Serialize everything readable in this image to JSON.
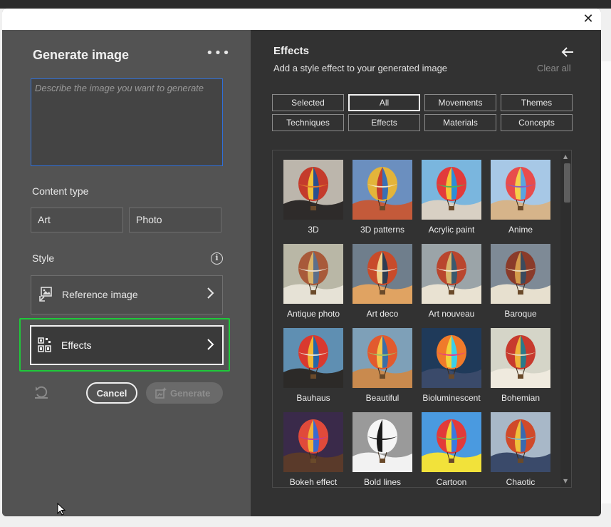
{
  "dialog": {
    "close_icon": "close-icon"
  },
  "left_panel": {
    "title": "Generate image",
    "more_label": "•••",
    "prompt": {
      "placeholder": "Describe the image you want to generate",
      "value": ""
    },
    "content_type": {
      "label": "Content type",
      "options": [
        "Art",
        "Photo"
      ]
    },
    "style": {
      "label": "Style",
      "info_glyph": "i",
      "reference_image_label": "Reference image",
      "effects_label": "Effects"
    },
    "actions": {
      "cancel": "Cancel",
      "generate": "Generate"
    }
  },
  "right_panel": {
    "title": "Effects",
    "subtitle": "Add a style effect to your generated image",
    "clear_all": "Clear all",
    "filters": [
      "Selected",
      "All",
      "Movements",
      "Themes",
      "Techniques",
      "Effects",
      "Materials",
      "Concepts"
    ],
    "active_filter": "All",
    "effects": [
      {
        "label": "3D",
        "sky": "#bcb6ac",
        "ground": "#2e2b2a",
        "balloon": [
          "#c43b2c",
          "#f0c238",
          "#2a4f8f",
          "#e07a2c"
        ]
      },
      {
        "label": "3D patterns",
        "sky": "#6b8fbf",
        "ground": "#c45a3a",
        "balloon": [
          "#e3b43a",
          "#c23b2f",
          "#3b6fb5",
          "#f3e4c0"
        ]
      },
      {
        "label": "Acrylic paint",
        "sky": "#7ab6de",
        "ground": "#d8d0c4",
        "balloon": [
          "#e23b3b",
          "#f7c236",
          "#2d8fd6",
          "#50b45a"
        ]
      },
      {
        "label": "Anime",
        "sky": "#a7c8e6",
        "ground": "#d6b48a",
        "balloon": [
          "#e84c4c",
          "#f5d04a",
          "#5aa5e0",
          "#8a5fc2"
        ]
      },
      {
        "label": "Antique photo",
        "sky": "#b9b7a6",
        "ground": "#e6e2d6",
        "balloon": [
          "#a85a3a",
          "#d9b46a",
          "#5c6f8a",
          "#e7dccb"
        ]
      },
      {
        "label": "Art deco",
        "sky": "#6f7e8c",
        "ground": "#e0a362",
        "balloon": [
          "#c84b2a",
          "#f0d08a",
          "#2e3d52",
          "#e6e0d0"
        ]
      },
      {
        "label": "Art nouveau",
        "sky": "#9ba4a8",
        "ground": "#e9e2d2",
        "balloon": [
          "#b9462e",
          "#d7b56b",
          "#3a5a6e",
          "#efe6d4"
        ]
      },
      {
        "label": "Baroque",
        "sky": "#7e8a96",
        "ground": "#e7e0cf",
        "balloon": [
          "#8a3b2a",
          "#d49a4a",
          "#3b4b5e",
          "#e9d9b8"
        ]
      },
      {
        "label": "Bauhaus",
        "sky": "#5f8fb2",
        "ground": "#2c2a28",
        "balloon": [
          "#d9392f",
          "#f2b833",
          "#2566a8",
          "#e8e2d0"
        ]
      },
      {
        "label": "Beautiful",
        "sky": "#7ea0b8",
        "ground": "#c98a4e",
        "balloon": [
          "#e25a2e",
          "#f4c64a",
          "#3a6fa8",
          "#9ac46a"
        ]
      },
      {
        "label": "Bioluminescent",
        "sky": "#1f3a5a",
        "ground": "#3a4a6a",
        "balloon": [
          "#f07a2a",
          "#f2d23a",
          "#3ad0e8",
          "#e83a8a"
        ]
      },
      {
        "label": "Bohemian",
        "sky": "#d5d5c8",
        "ground": "#efeade",
        "balloon": [
          "#c73a2e",
          "#f0b238",
          "#2a7a8a",
          "#e8d8b8"
        ]
      },
      {
        "label": "Bokeh effect",
        "sky": "#3a2a4a",
        "ground": "#5a3a2a",
        "balloon": [
          "#e04a3a",
          "#f2b23a",
          "#3a6ad0",
          "#c03a9a"
        ]
      },
      {
        "label": "Bold lines",
        "sky": "#9a9a9a",
        "ground": "#f2f2f2",
        "balloon": [
          "#f5f5f5",
          "#1a1a1a",
          "#f5f5f5",
          "#1a1a1a"
        ]
      },
      {
        "label": "Cartoon",
        "sky": "#4a9ae0",
        "ground": "#f2e23a",
        "balloon": [
          "#e23a3a",
          "#f5d23a",
          "#3a7ae0",
          "#5ac05a"
        ]
      },
      {
        "label": "Chaotic",
        "sky": "#a8b8c8",
        "ground": "#3a4a6a",
        "balloon": [
          "#d04a2a",
          "#f0c03a",
          "#3a6ab0",
          "#7ac0d0"
        ]
      }
    ]
  }
}
